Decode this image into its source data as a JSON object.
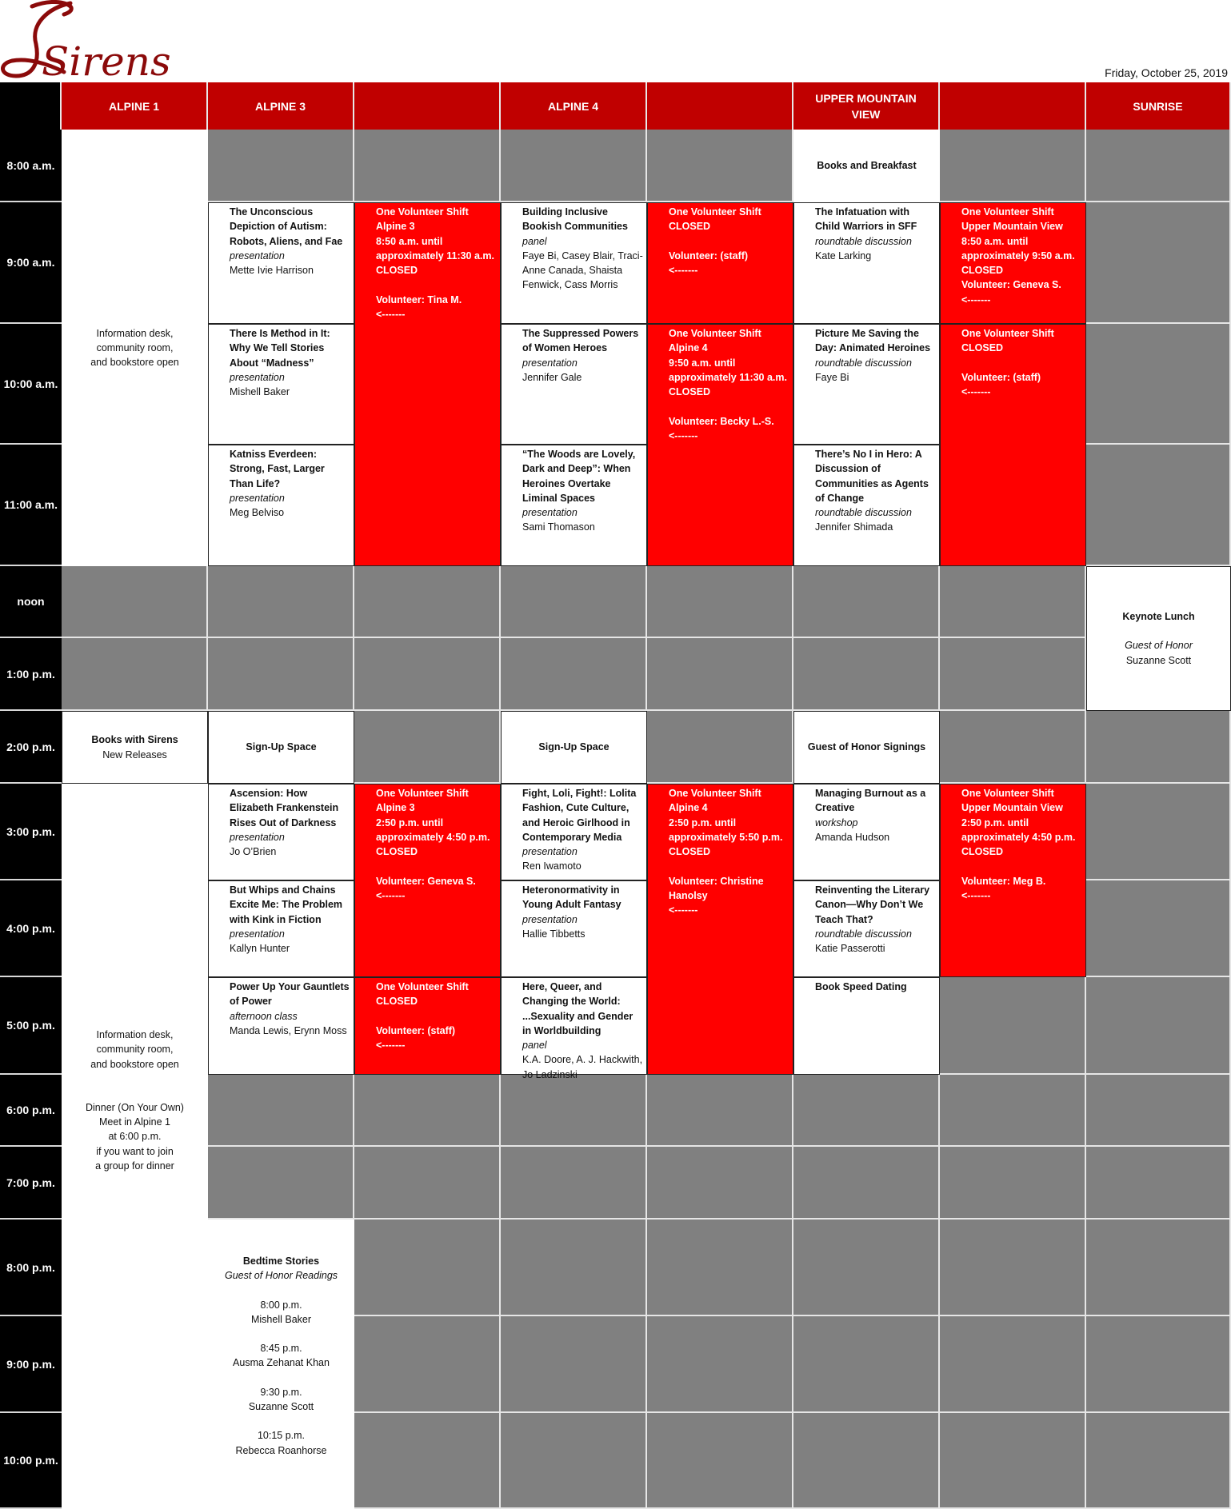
{
  "logo_text": "Sirens",
  "date": "Friday, October 25, 2019",
  "colors": {
    "header": "#c00000",
    "volunteer": "#ff0000",
    "unused": "#808080",
    "time_column": "#000000",
    "logo": "#8b0a0a"
  },
  "headers": [
    "",
    "ALPINE 1",
    "ALPINE 3",
    "",
    "ALPINE 4",
    "",
    "UPPER MOUNTAIN VIEW",
    "",
    "SUNRISE"
  ],
  "times": [
    "8:00 a.m.",
    "9:00 a.m.",
    "10:00 a.m.",
    "11:00 a.m.",
    "noon",
    "1:00 p.m.",
    "2:00 p.m.",
    "3:00 p.m.",
    "4:00 p.m.",
    "5:00 p.m.",
    "6:00 p.m.",
    "7:00 p.m.",
    "8:00 p.m.",
    "9:00 p.m.",
    "10:00 p.m."
  ],
  "alpine1": {
    "morning": [
      "Information desk,",
      "community room,",
      "and bookstore open"
    ],
    "books_with_sirens": {
      "title": "Books with Sirens",
      "subtitle": "New Releases"
    },
    "afternoon": [
      "Information desk,",
      "community room,",
      "and bookstore open"
    ],
    "dinner": [
      "Dinner (On Your Own)",
      "Meet in Alpine 1",
      "at 6:00 p.m.",
      "if you want to join",
      "a group for dinner"
    ]
  },
  "sessions": {
    "a3_9": {
      "title": "The Unconscious Depiction of Autism: Robots, Aliens, and Fae",
      "kind": "presentation",
      "people": "Mette Ivie Harrison"
    },
    "a3_10": {
      "title": "There Is Method in It: Why We Tell Stories About “Madness”",
      "kind": "presentation",
      "people": "Mishell Baker"
    },
    "a3_11": {
      "title": "Katniss Everdeen: Strong, Fast, Larger Than Life?",
      "kind": "presentation",
      "people": "Meg Belviso"
    },
    "a4_9": {
      "title": "Building Inclusive Bookish Communities",
      "kind": "panel",
      "people": "Faye Bi, Casey Blair, Traci-Anne Canada, Shaista Fenwick, Cass Morris"
    },
    "a4_10": {
      "title": "The Suppressed Powers of Women Heroes",
      "kind": "presentation",
      "people": "Jennifer Gale"
    },
    "a4_11": {
      "title": "“The Woods are Lovely, Dark and Deep”: When Heroines Overtake Liminal Spaces",
      "kind": "presentation",
      "people": "Sami Thomason"
    },
    "umv_9": {
      "title": "The Infatuation with Child Warriors in SFF",
      "kind": "roundtable discussion",
      "people": "Kate Larking"
    },
    "umv_10": {
      "title": "Picture Me Saving the Day: Animated Heroines",
      "kind": "roundtable discussion",
      "people": "Faye Bi"
    },
    "umv_11": {
      "title": "There’s No I in Hero: A Discussion of Communities as Agents of Change",
      "kind": "roundtable discussion",
      "people": "Jennifer Shimada"
    },
    "a3_3": {
      "title": "Ascension: How Elizabeth Frankenstein Rises Out of Darkness",
      "kind": "presentation",
      "people": "Jo O’Brien"
    },
    "a3_4": {
      "title": "But Whips and Chains Excite Me: The Problem with Kink in Fiction",
      "kind": "presentation",
      "people": "Kallyn Hunter"
    },
    "a3_5": {
      "title": "Power Up Your Gauntlets of Power",
      "kind": "afternoon class",
      "people": "Manda Lewis, Erynn Moss"
    },
    "a4_3": {
      "title": "Fight, Loli, Fight!: Lolita Fashion, Cute Culture, and Heroic Girlhood in Contemporary Media",
      "kind": "presentation",
      "people": "Ren Iwamoto"
    },
    "a4_4": {
      "title": "Heteronormativity in Young Adult Fantasy",
      "kind": "presentation",
      "people": "Hallie Tibbetts"
    },
    "a4_5": {
      "title": "Here, Queer, and Changing the World: ...Sexuality and Gender in Worldbuilding",
      "kind": "panel",
      "people": "K.A. Doore, A. J. Hackwith, Jo Ladzinski"
    },
    "umv_3": {
      "title": "Managing Burnout as a Creative",
      "kind": "workshop",
      "people": "Amanda Hudson"
    },
    "umv_4": {
      "title": "Reinventing the Literary Canon—Why Don’t We Teach That?",
      "kind": "roundtable discussion",
      "people": "Katie Passerotti"
    },
    "umv_5": {
      "title": "Book Speed Dating",
      "kind": "",
      "people": ""
    }
  },
  "events": {
    "books_and_breakfast": "Books and Breakfast",
    "signup_a3": "Sign-Up Space",
    "signup_a4": "Sign-Up Space",
    "goh_signings": "Guest of Honor Signings",
    "keynote": {
      "title": "Keynote Lunch",
      "subtitle": "Guest of Honor",
      "name": "Suzanne Scott"
    },
    "bedtime": {
      "title": "Bedtime Stories",
      "subtitle": "Guest of Honor Readings",
      "readings": [
        {
          "time": "8:00 p.m.",
          "name": "Mishell Baker"
        },
        {
          "time": "8:45 p.m.",
          "name": "Ausma Zehanat Khan"
        },
        {
          "time": "9:30 p.m.",
          "name": "Suzanne Scott"
        },
        {
          "time": "10:15 p.m.",
          "name": "Rebecca Roanhorse"
        }
      ]
    }
  },
  "volunteer_shifts": {
    "a3_am": "One Volunteer Shift\nAlpine 3\n8:50 a.m. until\napproximately 11:30 a.m.\nCLOSED\n\nVolunteer: Tina M.\n<-------",
    "a4_9": "One Volunteer Shift\nCLOSED\n\nVolunteer: (staff)\n<-------",
    "a4_am": "One Volunteer Shift\nAlpine 4\n9:50 a.m. until\napproximately 11:30 a.m.\nCLOSED\n\nVolunteer: Becky L.-S.\n<-------",
    "umv_9": "One Volunteer Shift\nUpper Mountain View\n8:50 a.m. until\napproximately 9:50 a.m.\nCLOSED\nVolunteer: Geneva S.\n<-------",
    "umv_am": "One Volunteer Shift\nCLOSED\n\nVolunteer: (staff)\n<-------",
    "a3_pm": "One Volunteer Shift\nAlpine 3\n2:50 p.m. until\napproximately 4:50 p.m.\nCLOSED\n\nVolunteer: Geneva S.\n<-------",
    "a3_5": "One Volunteer Shift\nCLOSED\n\nVolunteer: (staff)\n<-------",
    "a4_pm": "One Volunteer Shift\nAlpine 4\n2:50 p.m. until\napproximately 5:50 p.m.\nCLOSED\n\nVolunteer: Christine Hanolsy\n<-------",
    "umv_pm": "One Volunteer Shift\nUpper Mountain View\n2:50 p.m. until\napproximately 4:50 p.m.\nCLOSED\n\nVolunteer: Meg B.\n<-------"
  }
}
